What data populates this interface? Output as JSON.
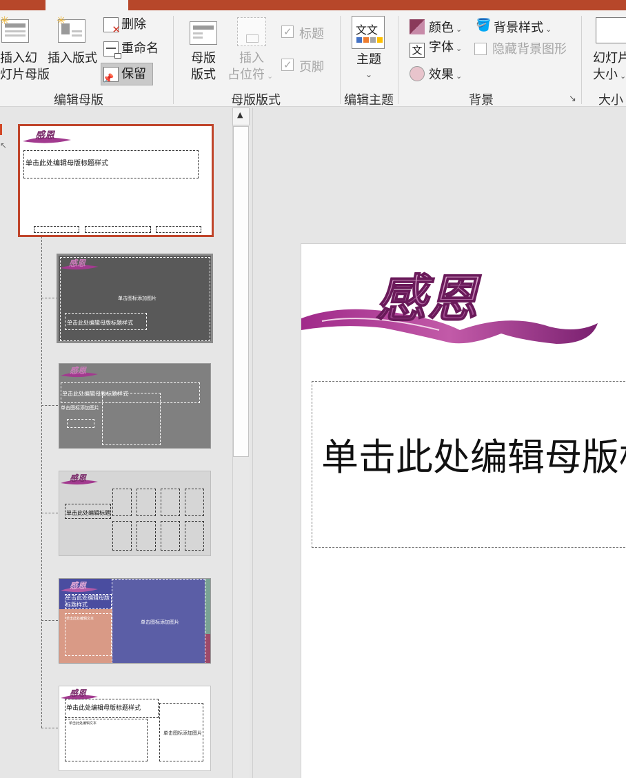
{
  "ribbon": {
    "groups": {
      "edit_master": "编辑母版",
      "master_layout": "母版版式",
      "edit_theme": "编辑主题",
      "background": "背景",
      "size": "大小"
    },
    "insert_slide_master": [
      "插入幻",
      "灯片母版"
    ],
    "insert_layout": "插入版式",
    "delete": "删除",
    "rename": "重命名",
    "preserve": "保留",
    "master_layout_btn": [
      "母版",
      "版式"
    ],
    "insert_placeholder": [
      "插入",
      "占位符"
    ],
    "title_check": "标题",
    "footer_check": "页脚",
    "themes": "主题",
    "colors": "颜色",
    "fonts": "字体",
    "effects": "效果",
    "background_styles": "背景样式",
    "hide_background": "隐藏背景图形",
    "slide_size": [
      "幻灯片",
      "大小"
    ]
  },
  "thumbnails": {
    "master_title": "单击此处编辑母版标题样式",
    "layout2_picture": "单击图标添加图片",
    "layout2_title": "单击此处编辑母版标题样式",
    "layout3_title": "单击此处编辑母版标题样式",
    "layout3_sub": "单击图标添加图片",
    "layout4_title": "单击此处编辑标题",
    "layout5_title": "单击此处编辑母版标题样式",
    "layout5_text": "单击此处编辑文本",
    "layout5_picture": "单击图标添加图片",
    "layout6_title": "单击此处编辑母版标题样式",
    "layout6_text": "单击此处编辑文本",
    "layout6_picture": "单击图标添加图片"
  },
  "slide": {
    "title": "单击此处编辑母版标题样式",
    "logo_text": "感恩"
  },
  "colors": {
    "accent": "#b7472a",
    "logo": "#a23a8f",
    "slide2_bg": "#595959",
    "slide3_bg": "#808080",
    "slide4_bg": "#d6d6d6",
    "slide5_left": "#5b5ea6",
    "slide5_pink": "#d99a86"
  }
}
